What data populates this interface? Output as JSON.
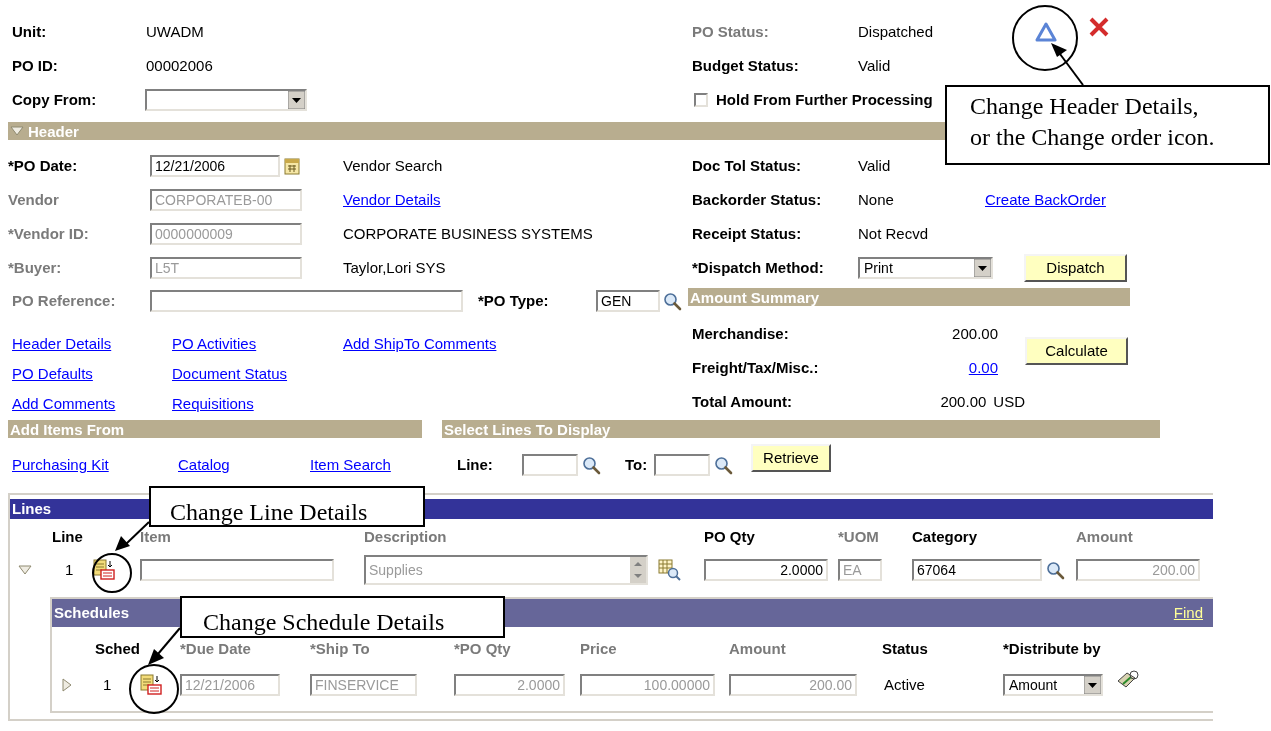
{
  "top_left": [
    {
      "label": "Unit:",
      "value": "UWADM"
    },
    {
      "label": "PO ID:",
      "value": "00002006"
    }
  ],
  "copy_from": {
    "label": "Copy From:"
  },
  "top_right": [
    {
      "label": "PO Status:",
      "value": "Dispatched",
      "disabled": true
    },
    {
      "label": "Budget Status:",
      "value": "Valid",
      "disabled": false
    }
  ],
  "hold": {
    "label": "Hold From Further Processing",
    "checked": false
  },
  "header_section": {
    "title": "Header",
    "expanded": true
  },
  "header_fields": [
    {
      "label": "*PO Date:",
      "value": "12/21/2006",
      "disabled": false,
      "kind": "date",
      "side": {
        "kind": "text",
        "text": "Vendor Search"
      }
    },
    {
      "label": "Vendor",
      "value": "CORPORATEB-00",
      "disabled": true,
      "kind": "text",
      "side": {
        "kind": "link",
        "text": "Vendor Details"
      }
    },
    {
      "label": "*Vendor ID:",
      "value": "0000000009",
      "disabled": true,
      "kind": "text",
      "side": {
        "kind": "text",
        "text": "CORPORATE BUSINESS SYSTEMS"
      }
    },
    {
      "label": "*Buyer:",
      "value": "L5T",
      "disabled": true,
      "kind": "text",
      "side": {
        "kind": "text",
        "text": "Taylor,Lori  SYS"
      }
    }
  ],
  "po_reference": {
    "label": "PO Reference:",
    "disabled": true
  },
  "po_type": {
    "label": "*PO Type:",
    "value": "GEN"
  },
  "status_fields": [
    {
      "label": "Doc Tol Status:",
      "value": "Valid"
    },
    {
      "label": "Backorder Status:",
      "value": "None",
      "link": "Create BackOrder"
    },
    {
      "label": "Receipt Status:",
      "value": "Not Recvd"
    }
  ],
  "dispatch": {
    "label": "*Dispatch Method:",
    "value": "Print",
    "button": "Dispatch"
  },
  "amount_summary": {
    "title": "Amount Summary",
    "button": "Calculate",
    "rows": [
      {
        "label": "Merchandise:",
        "value": "200.00",
        "kind": "text"
      },
      {
        "label": "Freight/Tax/Misc.:",
        "value": "0.00",
        "kind": "link"
      },
      {
        "label": "Total Amount:",
        "value": "200.00",
        "currency": "USD",
        "kind": "text"
      }
    ]
  },
  "links": [
    [
      "Header Details",
      "PO Activities",
      "Add ShipTo Comments"
    ],
    [
      "PO Defaults",
      "Document Status"
    ],
    [
      "Add Comments",
      "Requisitions"
    ]
  ],
  "add_items": {
    "title": "Add Items From",
    "links": [
      "Purchasing Kit",
      "Catalog",
      "Item Search"
    ]
  },
  "select_lines": {
    "title": "Select Lines To Display",
    "line_label": "Line:",
    "to_label": "To:",
    "button": "Retrieve"
  },
  "lines": {
    "title": "Lines",
    "columns": [
      {
        "label": "Line",
        "disabled": false
      },
      {
        "label": "Item",
        "disabled": true
      },
      {
        "label": "Description",
        "disabled": true
      },
      {
        "label": "PO Qty",
        "disabled": false
      },
      {
        "label": "*UOM",
        "disabled": true
      },
      {
        "label": "Category",
        "disabled": false
      },
      {
        "label": "Amount",
        "disabled": true
      }
    ],
    "rows": [
      {
        "expanded": true,
        "line": "1",
        "description": "Supplies",
        "po_qty": "2.0000",
        "uom": "EA",
        "category": "67064",
        "amount": "200.00"
      }
    ]
  },
  "schedules": {
    "title": "Schedules",
    "find": "Find",
    "columns": [
      {
        "label": "Sched",
        "disabled": false
      },
      {
        "label": "*Due Date",
        "disabled": true
      },
      {
        "label": "*Ship To",
        "disabled": true
      },
      {
        "label": "*PO Qty",
        "disabled": true
      },
      {
        "label": "Price",
        "disabled": true
      },
      {
        "label": "Amount",
        "disabled": true
      },
      {
        "label": "Status",
        "disabled": false
      },
      {
        "label": "*Distribute by",
        "disabled": false
      }
    ],
    "rows": [
      {
        "expanded": false,
        "sched": "1",
        "due_date": "12/21/2006",
        "ship_to": "FINSERVICE",
        "po_qty": "2.0000",
        "price": "100.00000",
        "amount": "200.00",
        "status": "Active",
        "distribute_by": "Amount"
      }
    ]
  },
  "callouts": [
    {
      "kind": "header",
      "text": "Change Header Details,\nor the Change order icon."
    },
    {
      "kind": "line",
      "text": "Change Line Details"
    },
    {
      "kind": "schedule",
      "text": "Change Schedule Details"
    }
  ]
}
